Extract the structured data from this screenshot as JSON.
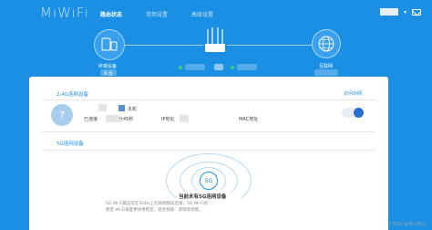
{
  "app": {
    "logo": "MiWiFi"
  },
  "nav": [
    {
      "label": "路由状态",
      "active": true
    },
    {
      "label": "常用设置",
      "active": false
    },
    {
      "label": "高级设置",
      "active": false
    }
  ],
  "topology": {
    "devices_label": "终端设备",
    "devices_count": "9 台",
    "internet_label": "互联网"
  },
  "section_24g": {
    "title": "2.4G连网设备",
    "link": "访问外网",
    "device": {
      "icon": "?",
      "tag": "本机",
      "connected": "已连接",
      "duration_suffix": "分45秒",
      "ip_label": "IP地址",
      "mac_label": "MAC地址"
    }
  },
  "section_5g": {
    "title": "5G连网设备",
    "badge": "5G",
    "empty_title": "当前未有5G连网设备",
    "desc_1": "5G Wi-Fi最远可在5GHz上的高频频段连接，5G Wi-Fi的",
    "desc_2": "稳定 Wi-Fi速度更快更稳定，适合视频、游戏等场景。"
  },
  "watermark": "CSDN @良心好心",
  "colors": {
    "brand": "#1a8fe3",
    "toggle": "#2b6fd1"
  }
}
